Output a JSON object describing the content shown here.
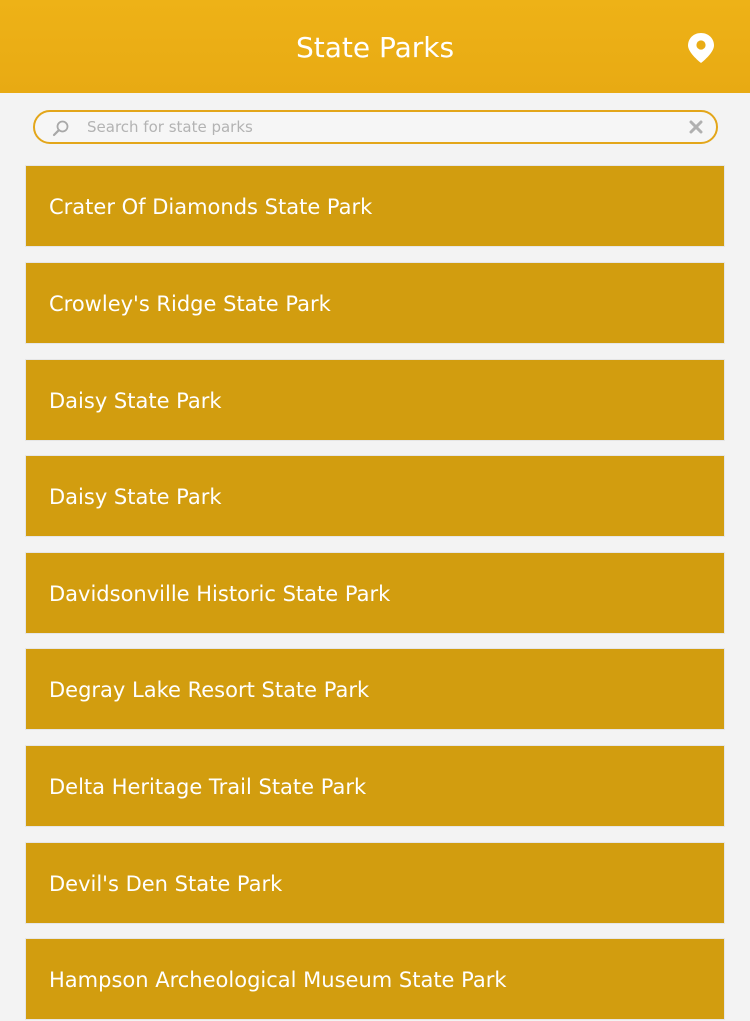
{
  "header": {
    "title": "State Parks",
    "location_icon": "map-pin-icon"
  },
  "search": {
    "placeholder": "Search for state parks",
    "value": "",
    "search_icon": "magnifier-icon",
    "clear_icon": "clear-x-icon"
  },
  "parks": [
    {
      "label": "Crater Of Diamonds State Park"
    },
    {
      "label": "Crowley's Ridge State Park"
    },
    {
      "label": "Daisy State Park"
    },
    {
      "label": "Daisy State Park"
    },
    {
      "label": "Davidsonville Historic State Park"
    },
    {
      "label": "Degray Lake Resort State Park"
    },
    {
      "label": "Delta Heritage Trail State Park"
    },
    {
      "label": "Devil's Den State Park"
    },
    {
      "label": "Hampson Archeological Museum State Park"
    }
  ],
  "colors": {
    "header": "#eeb217",
    "row": "#d29d0f",
    "search_border": "#e3a61a",
    "background": "#f3f3f3",
    "text": "#ffffff"
  }
}
